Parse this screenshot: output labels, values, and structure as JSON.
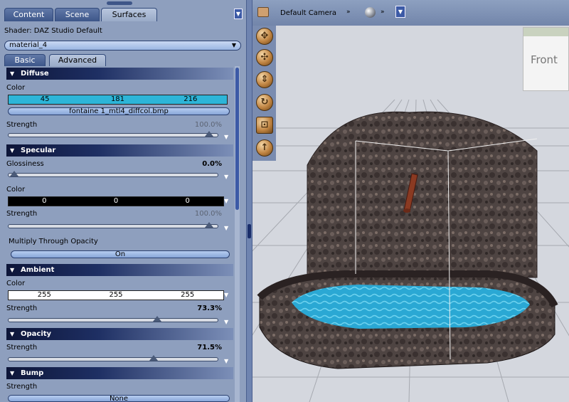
{
  "tabs": [
    "Content",
    "Scene",
    "Surfaces"
  ],
  "tabs_menu_icon": "menu-dropdown-icon",
  "shader_label": "Shader: DAZ Studio Default",
  "material": "material_4",
  "sub_tabs": [
    "Basic",
    "Advanced"
  ],
  "sections": {
    "diffuse": {
      "title": "Diffuse",
      "color_label": "Color",
      "color": [
        "45",
        "181",
        "216"
      ],
      "color_hex": "#2db5d8",
      "texture": "fontaine 1_mtl4_diffcol.bmp",
      "strength_label": "Strength",
      "strength": "100.0%",
      "strength_value": 1.0
    },
    "specular": {
      "title": "Specular",
      "glossiness_label": "Glossiness",
      "glossiness": "0.0%",
      "glossiness_value": 0.0,
      "color_label": "Color",
      "color": [
        "0",
        "0",
        "0"
      ],
      "color_hex": "#000000",
      "strength_label": "Strength",
      "strength": "100.0%",
      "strength_value": 1.0,
      "multiply_label": "Multiply Through Opacity",
      "multiply_value": "On"
    },
    "ambient": {
      "title": "Ambient",
      "color_label": "Color",
      "color": [
        "255",
        "255",
        "255"
      ],
      "color_hex": "#ffffff",
      "strength_label": "Strength",
      "strength": "73.3%",
      "strength_value": 0.733
    },
    "opacity": {
      "title": "Opacity",
      "strength_label": "Strength",
      "strength": "71.5%",
      "strength_value": 0.715
    },
    "bump": {
      "title": "Bump",
      "strength_label": "Strength",
      "texture": "None"
    }
  },
  "viewport": {
    "camera": "Default Camera",
    "camera_icon": "camera-icon",
    "shading_icon": "shading-sphere-icon",
    "view_cube_label": "Front",
    "nav_icons": [
      "pan-icon",
      "orbit-icon",
      "dolly-icon",
      "rotate-icon",
      "frame-icon",
      "up-arrow-icon"
    ]
  },
  "colors": {
    "panel_bg": "#8e9fbe",
    "accent": "#3c5aa6",
    "water": "#2aa8d4",
    "stone": "#4e4442"
  }
}
